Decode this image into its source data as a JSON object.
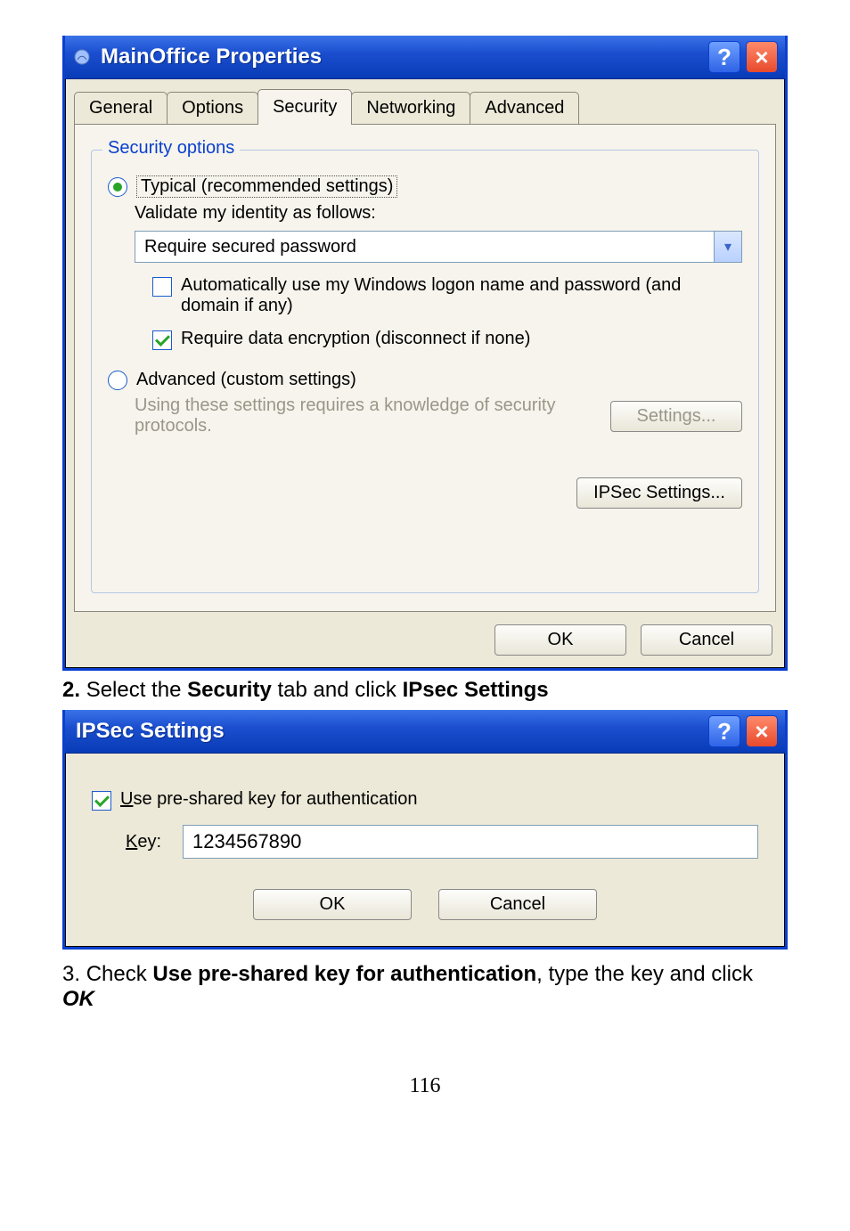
{
  "dialog1": {
    "title": "MainOffice Properties",
    "tabs": [
      "General",
      "Options",
      "Security",
      "Networking",
      "Advanced"
    ],
    "active_tab": "Security",
    "group_title": "Security options",
    "radio_typical": "Typical (recommended settings)",
    "validate_label": "Validate my identity as follows:",
    "validate_value": "Require secured password",
    "auto_logon": "Automatically use my Windows logon name and password (and domain if any)",
    "require_encrypt": "Require data encryption (disconnect if none)",
    "radio_advanced": "Advanced (custom settings)",
    "advanced_hint": "Using these settings requires a knowledge of security protocols.",
    "settings_btn": "Settings...",
    "ipsec_btn": "IPSec Settings...",
    "ok": "OK",
    "cancel": "Cancel"
  },
  "instr1": {
    "num": "2.",
    "a": "Select the ",
    "b": "Security",
    "c": " tab and click ",
    "d": "IPsec Settings"
  },
  "dialog2": {
    "title": "IPSec Settings",
    "use_psk": "Use pre-shared key for authentication",
    "key_label": "Key:",
    "key_value": "1234567890",
    "ok": "OK",
    "cancel": "Cancel"
  },
  "instr2": {
    "num": "3. ",
    "a": "Check ",
    "b": "Use pre-shared key for authentication",
    "c": ", type the key and click ",
    "d": "OK"
  },
  "page_number": "116"
}
